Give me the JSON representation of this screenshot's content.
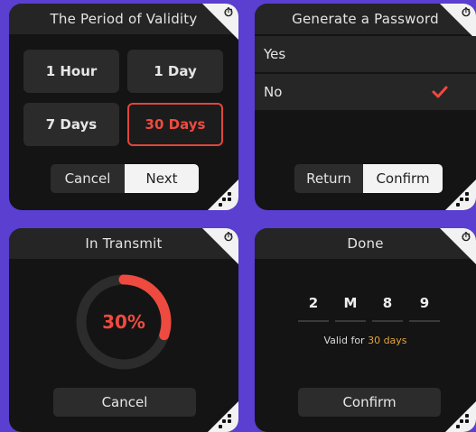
{
  "panels": {
    "validity": {
      "title": "The Period of Validity",
      "options": [
        "1 Hour",
        "1 Day",
        "7 Days",
        "30 Days"
      ],
      "selected_option": "30 Days",
      "cancel_label": "Cancel",
      "next_label": "Next"
    },
    "password": {
      "title": "Generate a Password",
      "options": [
        "Yes",
        "No"
      ],
      "selected_option": "No",
      "return_label": "Return",
      "confirm_label": "Confirm"
    },
    "transmit": {
      "title": "In Transmit",
      "progress_label": "30%",
      "progress": 0.3,
      "cancel_label": "Cancel"
    },
    "done": {
      "title": "Done",
      "code": [
        "2",
        "M",
        "8",
        "9"
      ],
      "valid_prefix": "Valid for ",
      "valid_value": "30 days",
      "confirm_label": "Confirm"
    }
  },
  "colors": {
    "accent": "#ef4a3f",
    "highlight": "#e0a43a",
    "background": "#5a3fd0",
    "panel": "#141414"
  }
}
